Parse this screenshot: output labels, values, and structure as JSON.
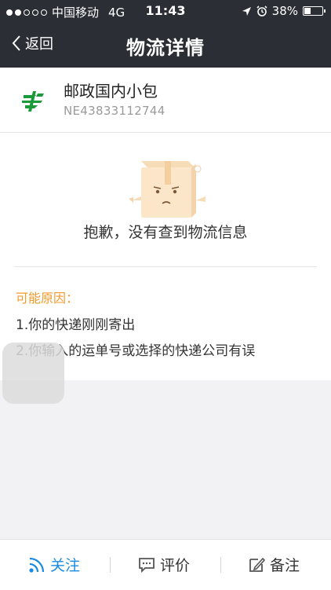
{
  "status_bar": {
    "carrier": "中国移动",
    "network": "4G",
    "time": "11:43",
    "battery_percent": "38%",
    "battery_level": 0.38
  },
  "nav": {
    "back_label": "返回",
    "title": "物流详情"
  },
  "package": {
    "name": "邮政国内小包",
    "tracking_number": "NE43833112744",
    "logo_icon": "china-post-logo",
    "logo_color": "#1a9a3a"
  },
  "empty_state": {
    "message": "抱歉，没有查到物流信息",
    "illustration_icon": "sad-box-icon"
  },
  "reasons": {
    "title": "可能原因：",
    "items": [
      "1.你的快递刚刚寄出",
      "2.你输入的运单号或选择的快递公司有误"
    ],
    "title_color": "#f39a2c"
  },
  "bottom_bar": {
    "follow_label": "关注",
    "review_label": "评价",
    "note_label": "备注",
    "active_color": "#1a8be0"
  }
}
